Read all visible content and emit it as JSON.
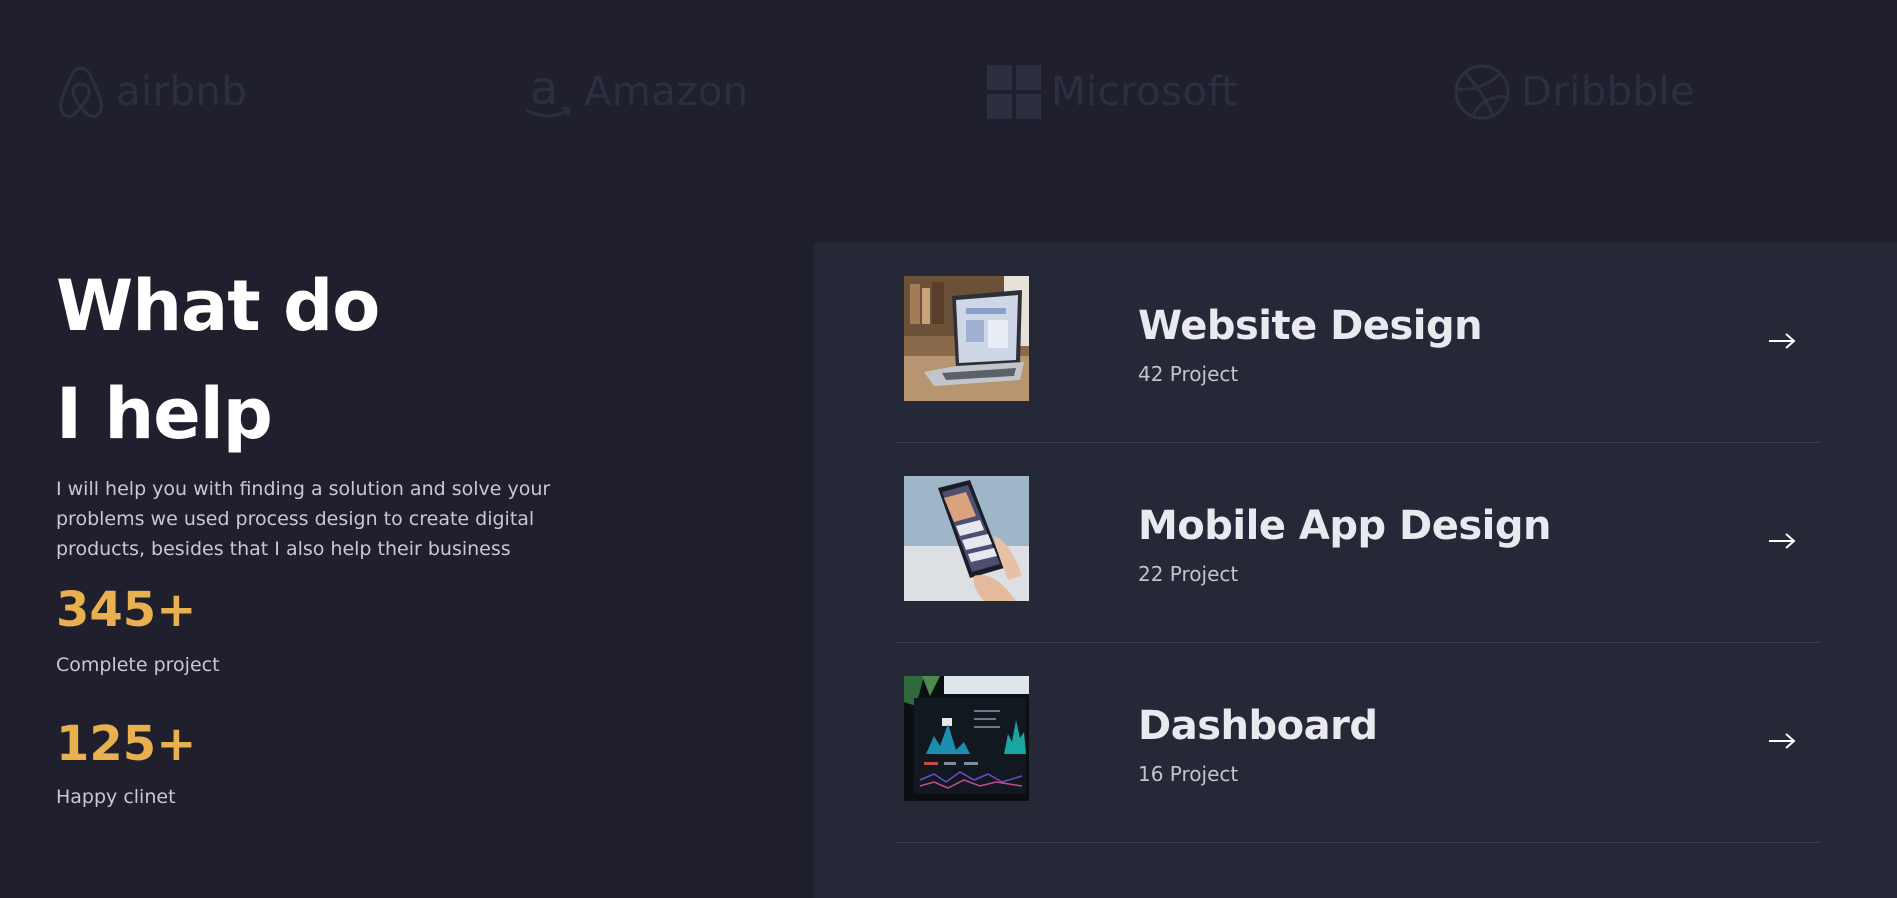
{
  "logos": [
    {
      "name": "airbnb",
      "icon": "airbnb-icon"
    },
    {
      "name": "Amazon",
      "icon": "amazon-icon"
    },
    {
      "name": "Microsoft",
      "icon": "microsoft-icon"
    },
    {
      "name": "Dribbble",
      "icon": "dribbble-icon"
    }
  ],
  "hero": {
    "heading_line1": "What do",
    "heading_line2": "I help",
    "description": "I will help you with finding a solution and solve your problems we used process design to create digital products, besides that I also help their business"
  },
  "stats": [
    {
      "value": "345+",
      "label": "Complete project"
    },
    {
      "value": "125+",
      "label": "Happy clinet"
    }
  ],
  "services": [
    {
      "title": "Website Design",
      "count": "42 Project",
      "thumbnail": "laptop-photo",
      "arrow": "arrow-right-icon"
    },
    {
      "title": "Mobile App Design",
      "count": "22 Project",
      "thumbnail": "phone-photo",
      "arrow": "arrow-right-icon"
    },
    {
      "title": "Dashboard",
      "count": "16 Project",
      "thumbnail": "dashboard-photo",
      "arrow": "arrow-right-icon"
    }
  ],
  "colors": {
    "background": "#1f1f2e",
    "panel": "#252837",
    "accent": "#e8b04e",
    "logo": "#2d2f40"
  }
}
